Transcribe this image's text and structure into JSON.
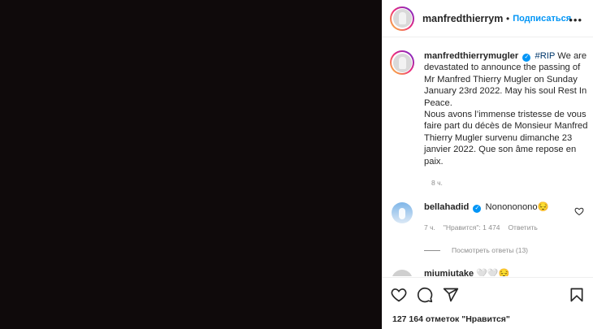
{
  "colors": {
    "accent": "#0095f6",
    "hashtag": "#00376b",
    "muted": "#8e8e8e",
    "media_bg": "#0f0a0b"
  },
  "header": {
    "username": "manfredthierrymugler",
    "dot": "•",
    "follow_label": "Подписаться",
    "more_icon": "more-icon"
  },
  "caption": {
    "username": "manfredthierrymugler",
    "hashtag": "#RIP",
    "text_en": "We are devastated to announce the passing of Mr Manfred Thierry Mugler on Sunday January 23rd 2022. May his soul Rest In Peace.",
    "text_fr": "Nous avons l’immense tristesse de vous faire part du décès de Monsieur Manfred Thierry Mugler survenu dimanche 23 janvier 2022. Que son âme repose en paix.",
    "time": "8 ч."
  },
  "comment": {
    "username": "bellahadid",
    "text": "Nonononono😔",
    "time": "7 ч.",
    "likes": "\"Нравится\": 1 474",
    "reply_label": "Ответить"
  },
  "replies": {
    "label": "Посмотреть ответы (13)"
  },
  "comment2": {
    "username": "miumiutake",
    "text": "🤍🤍😔"
  },
  "actions": {
    "likes": "127 164 отметок \"Нравится\""
  }
}
